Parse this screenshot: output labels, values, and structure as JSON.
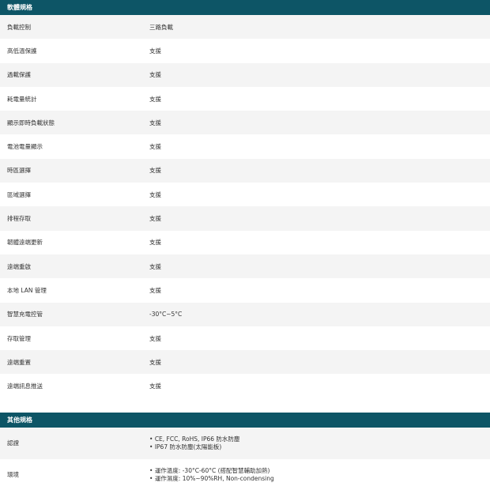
{
  "software": {
    "title": "軟體規格",
    "rows": [
      {
        "label": "負載控制",
        "value": "三路負載"
      },
      {
        "label": "高低溫保護",
        "value": "支援"
      },
      {
        "label": "過載保護",
        "value": "支援"
      },
      {
        "label": "耗電量統計",
        "value": "支援"
      },
      {
        "label": "顯示即時負載狀態",
        "value": "支援"
      },
      {
        "label": "電池電量顯示",
        "value": "支援"
      },
      {
        "label": "時區選擇",
        "value": "支援"
      },
      {
        "label": "區域選擇",
        "value": "支援"
      },
      {
        "label": "排程存取",
        "value": "支援"
      },
      {
        "label": "韌體遠端更新",
        "value": "支援"
      },
      {
        "label": "遠端重啟",
        "value": "支援"
      },
      {
        "label": "本地 LAN 管理",
        "value": "支援"
      },
      {
        "label": "智慧充電控管",
        "value": "-30°C~5°C"
      },
      {
        "label": "存取管理",
        "value": "支援"
      },
      {
        "label": "遠端重置",
        "value": "支援"
      },
      {
        "label": "遠端訊息推送",
        "value": "支援"
      }
    ]
  },
  "other": {
    "title": "其他規格",
    "rows": [
      {
        "label": "認證",
        "items": [
          "CE, FCC, RoHS, IP66 防水防塵",
          "IP67 防水防塵(太陽能板)"
        ]
      },
      {
        "label": "環境",
        "items": [
          "運作溫度: -30°C-60°C (搭配智慧輔助加熱)",
          "運作濕度: 10%~90%RH, Non-condensing"
        ]
      }
    ]
  }
}
